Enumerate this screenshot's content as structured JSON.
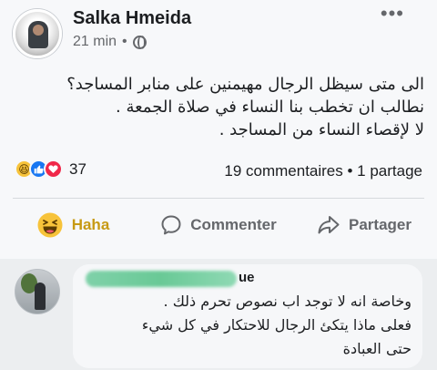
{
  "post": {
    "author": "Salka Hmeida",
    "time": "21 min",
    "separator": "•",
    "more_label": "•••",
    "text_lines": [
      "الى متى سيظل الرجال مهيمنين على منابر المساجد؟",
      "نطالب ان تخطب بنا النساء في صلاة الجمعة .",
      "لا لإقصاء النساء من المساجد ."
    ],
    "reactions": {
      "count": "37",
      "types": [
        "haha-icon",
        "like-icon",
        "love-icon"
      ]
    },
    "comments_shares": "19 commentaires • 1 partage",
    "actions": {
      "haha": "Haha",
      "comment": "Commenter",
      "share": "Partager"
    }
  },
  "comment": {
    "author_visible_suffix": "ue",
    "text_lines": [
      "وخاصة انه لا توجد اب نصوص تحرم ذلك .",
      "فعلى ماذا يتكئ الرجال للاحتكار  في كل شيء",
      "حتى العبادة"
    ]
  },
  "colors": {
    "haha_accent": "#c79a13",
    "secondary_text": "#65676b",
    "like_blue": "#1877f2",
    "love_red": "#f02849"
  }
}
